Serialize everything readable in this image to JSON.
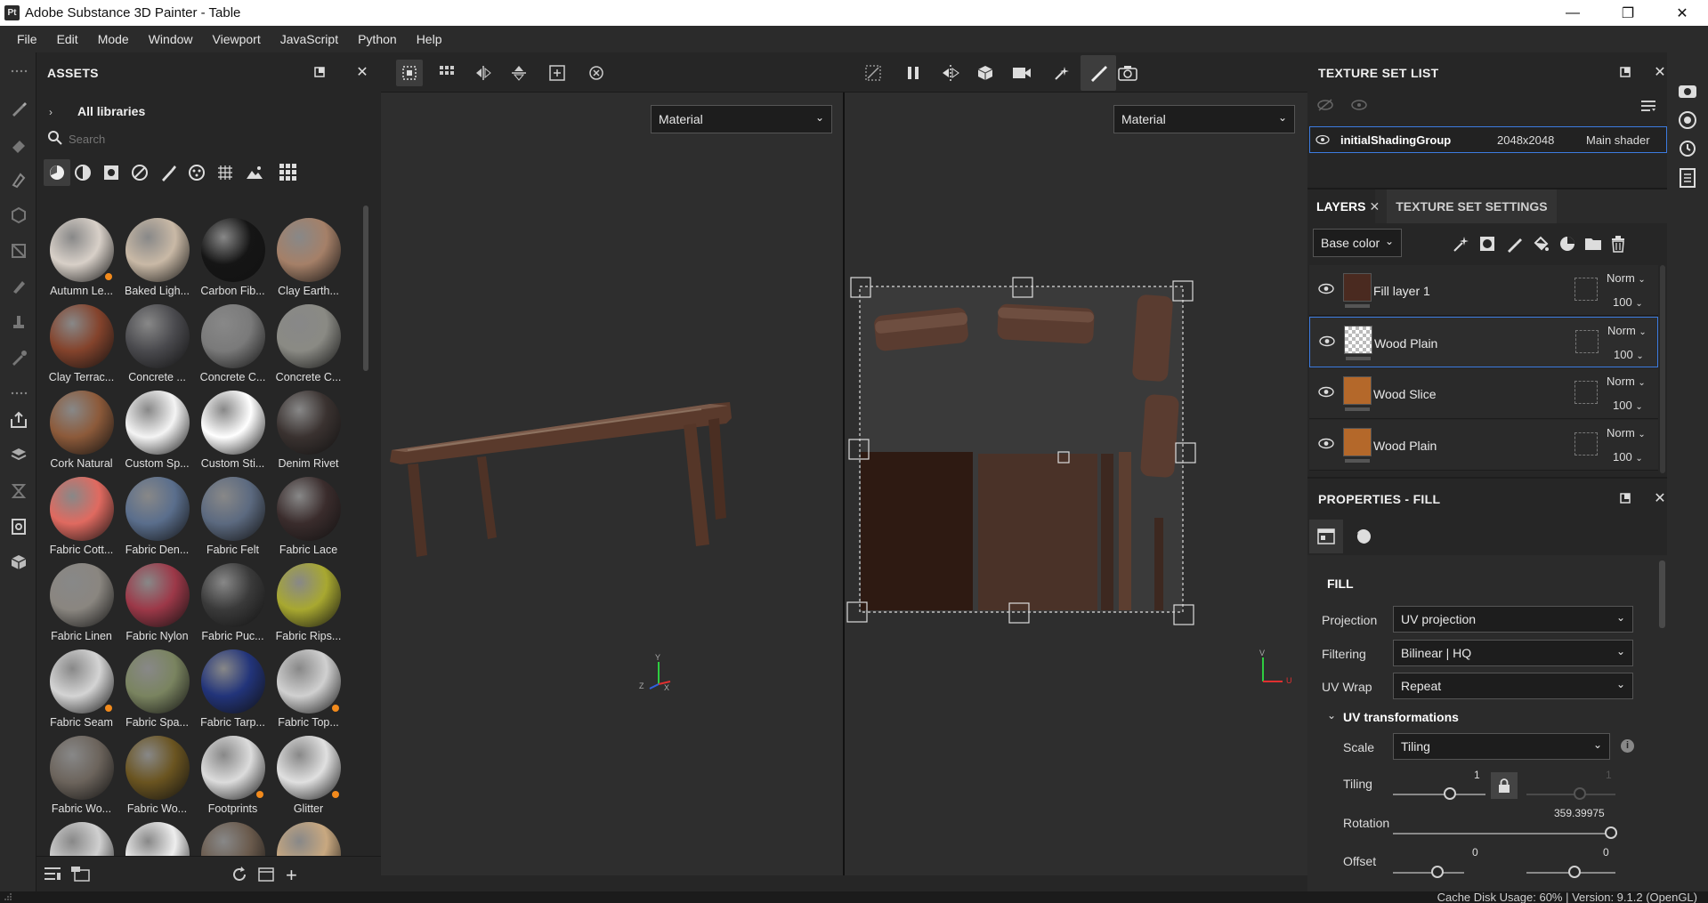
{
  "window": {
    "logo_text": "Pt",
    "title": "Adobe Substance 3D Painter - Table"
  },
  "menu": [
    "File",
    "Edit",
    "Mode",
    "Window",
    "Viewport",
    "JavaScript",
    "Python",
    "Help"
  ],
  "assets": {
    "title": "ASSETS",
    "breadcrumb": "All libraries",
    "search_placeholder": "Search",
    "items": [
      {
        "label": "Autumn Le...",
        "color": "#d8d0c8",
        "badge": true
      },
      {
        "label": "Baked Ligh...",
        "color": "#c9b9a6",
        "badge": false
      },
      {
        "label": "Carbon Fib...",
        "color": "#151515",
        "badge": false
      },
      {
        "label": "Clay Earth...",
        "color": "#a58068",
        "badge": false
      },
      {
        "label": "Clay Terrac...",
        "color": "#84432c",
        "badge": false
      },
      {
        "label": "Concrete ...",
        "color": "#4a4a4e",
        "badge": false
      },
      {
        "label": "Concrete C...",
        "color": "#7a7a7a",
        "badge": false
      },
      {
        "label": "Concrete C...",
        "color": "#8a8a84",
        "badge": false
      },
      {
        "label": "Cork Natural",
        "color": "#8c5a3a",
        "badge": false
      },
      {
        "label": "Custom Sp...",
        "color": "#f4f4f4",
        "badge": false
      },
      {
        "label": "Custom Sti...",
        "color": "#ffffff",
        "badge": false
      },
      {
        "label": "Denim Rivet",
        "color": "#3a3230",
        "badge": false
      },
      {
        "label": "Fabric Cott...",
        "color": "#e06a60",
        "badge": false
      },
      {
        "label": "Fabric Den...",
        "color": "#5a6e8c",
        "badge": false
      },
      {
        "label": "Fabric Felt",
        "color": "#5c6a80",
        "badge": false
      },
      {
        "label": "Fabric Lace",
        "color": "#3a2c2c",
        "badge": false
      },
      {
        "label": "Fabric Linen",
        "color": "#8a8680",
        "badge": false
      },
      {
        "label": "Fabric Nylon",
        "color": "#9c3848",
        "badge": false
      },
      {
        "label": "Fabric Puc...",
        "color": "#3a3a3a",
        "badge": false
      },
      {
        "label": "Fabric Rips...",
        "color": "#a8a830",
        "badge": false
      },
      {
        "label": "Fabric Seam",
        "color": "#d4d4d4",
        "badge": true
      },
      {
        "label": "Fabric Spa...",
        "color": "#7a8460",
        "badge": false
      },
      {
        "label": "Fabric Tarp...",
        "color": "#22347a",
        "badge": false
      },
      {
        "label": "Fabric Top...",
        "color": "#d0d0d0",
        "badge": true
      },
      {
        "label": "Fabric Wo...",
        "color": "#6c645c",
        "badge": false
      },
      {
        "label": "Fabric Wo...",
        "color": "#6a5420",
        "badge": false
      },
      {
        "label": "Footprints",
        "color": "#dcdcdc",
        "badge": true
      },
      {
        "label": "Glitter",
        "color": "#e0e0e0",
        "badge": true
      },
      {
        "label": "",
        "color": "#d0d0d0",
        "badge": false
      },
      {
        "label": "",
        "color": "#eeeeee",
        "badge": false
      },
      {
        "label": "",
        "color": "#6a5a4c",
        "badge": false
      },
      {
        "label": "",
        "color": "#c8a880",
        "badge": false
      }
    ]
  },
  "viewport_left": {
    "mode": "Material",
    "axis_x": "X",
    "axis_y": "Y",
    "axis_z": "Z"
  },
  "viewport_right": {
    "mode": "Material",
    "axis_u": "U",
    "axis_v": "V"
  },
  "texture_set_list": {
    "title": "TEXTURE SET LIST",
    "row": {
      "name": "initialShadingGroup",
      "resolution": "2048x2048",
      "shader": "Main shader"
    }
  },
  "layers_panel": {
    "tab_layers": "LAYERS",
    "tab_settings": "TEXTURE SET SETTINGS",
    "channel": "Base color",
    "layers": [
      {
        "name": "Fill layer 1",
        "blend": "Norm",
        "opacity": "100",
        "thumb": "#4a2a20",
        "selected": false
      },
      {
        "name": "Wood Plain",
        "blend": "Norm",
        "opacity": "100",
        "thumb": "checker",
        "selected": true
      },
      {
        "name": "Wood Slice",
        "blend": "Norm",
        "opacity": "100",
        "thumb": "#b4682a",
        "selected": false
      },
      {
        "name": "Wood Plain",
        "blend": "Norm",
        "opacity": "100",
        "thumb": "#b4682a",
        "selected": false
      }
    ]
  },
  "properties": {
    "title": "PROPERTIES - FILL",
    "section": "FILL",
    "projection_label": "Projection",
    "projection": "UV projection",
    "filtering_label": "Filtering",
    "filtering": "Bilinear | HQ",
    "uvwrap_label": "UV Wrap",
    "uvwrap": "Repeat",
    "uv_transformations": "UV transformations",
    "scale_label": "Scale",
    "scale": "Tiling",
    "tiling_label": "Tiling",
    "tiling_value": "1",
    "tiling_value2": "1",
    "rotation_label": "Rotation",
    "rotation_value": "359.39975",
    "offset_label": "Offset",
    "offset_value": "0",
    "offset_value2": "0"
  },
  "status": {
    "text": "Cache Disk Usage:  60% | Version: 9.1.2 (OpenGL)"
  },
  "colors": {
    "accent": "#3c7be0",
    "wood": "#5a3a2c",
    "badge": "#f28a1c"
  }
}
